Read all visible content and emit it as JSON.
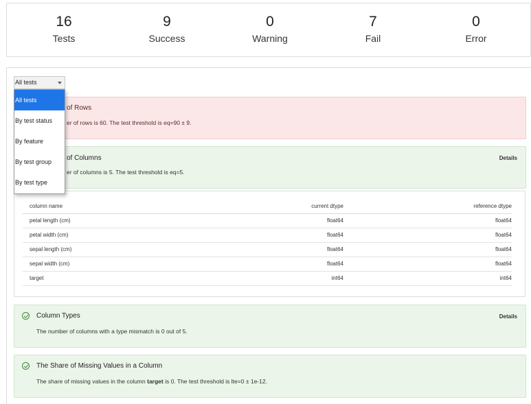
{
  "summary": [
    {
      "value": "16",
      "label": "Tests"
    },
    {
      "value": "9",
      "label": "Success"
    },
    {
      "value": "0",
      "label": "Warning"
    },
    {
      "value": "7",
      "label": "Fail"
    },
    {
      "value": "0",
      "label": "Error"
    }
  ],
  "filter": {
    "selected": "All tests",
    "options": [
      "All tests",
      "By test status",
      "By feature",
      "By test group",
      "By test type"
    ]
  },
  "tests": [
    {
      "title": "of Rows",
      "description": "er of rows is 60. The test threshold is eq=90 ± 9.",
      "status": "fail"
    },
    {
      "title": "of Columns",
      "description": "er of columns is 5. The test threshold is eq=5.",
      "status": "success",
      "details_label": "Details"
    },
    {
      "title": "Column Types",
      "description": "The number of columns with a type mismatch is 0 out of 5.",
      "status": "success",
      "details_label": "Details"
    },
    {
      "title": "The Share of Missing Values in a Column",
      "description_prefix": "The share of missing values in the column ",
      "description_bold": "target",
      "description_suffix": " is 0. The test threshold is lte=0 ± 1e-12.",
      "status": "success"
    }
  ],
  "details_table": {
    "headers": [
      "column name",
      "current dtype",
      "reference dtype"
    ],
    "rows": [
      [
        "petal length (cm)",
        "float64",
        "float64"
      ],
      [
        "petal width (cm)",
        "float64",
        "float64"
      ],
      [
        "sepal length (cm)",
        "float64",
        "float64"
      ],
      [
        "sepal width (cm)",
        "float64",
        "float64"
      ],
      [
        "target",
        "int64",
        "int64"
      ]
    ]
  },
  "colors": {
    "fail_bg": "#fbe7e7",
    "success_bg": "#ebf5e9",
    "selected_option": "#1e75e8",
    "check_icon": "#3c8a3c"
  }
}
